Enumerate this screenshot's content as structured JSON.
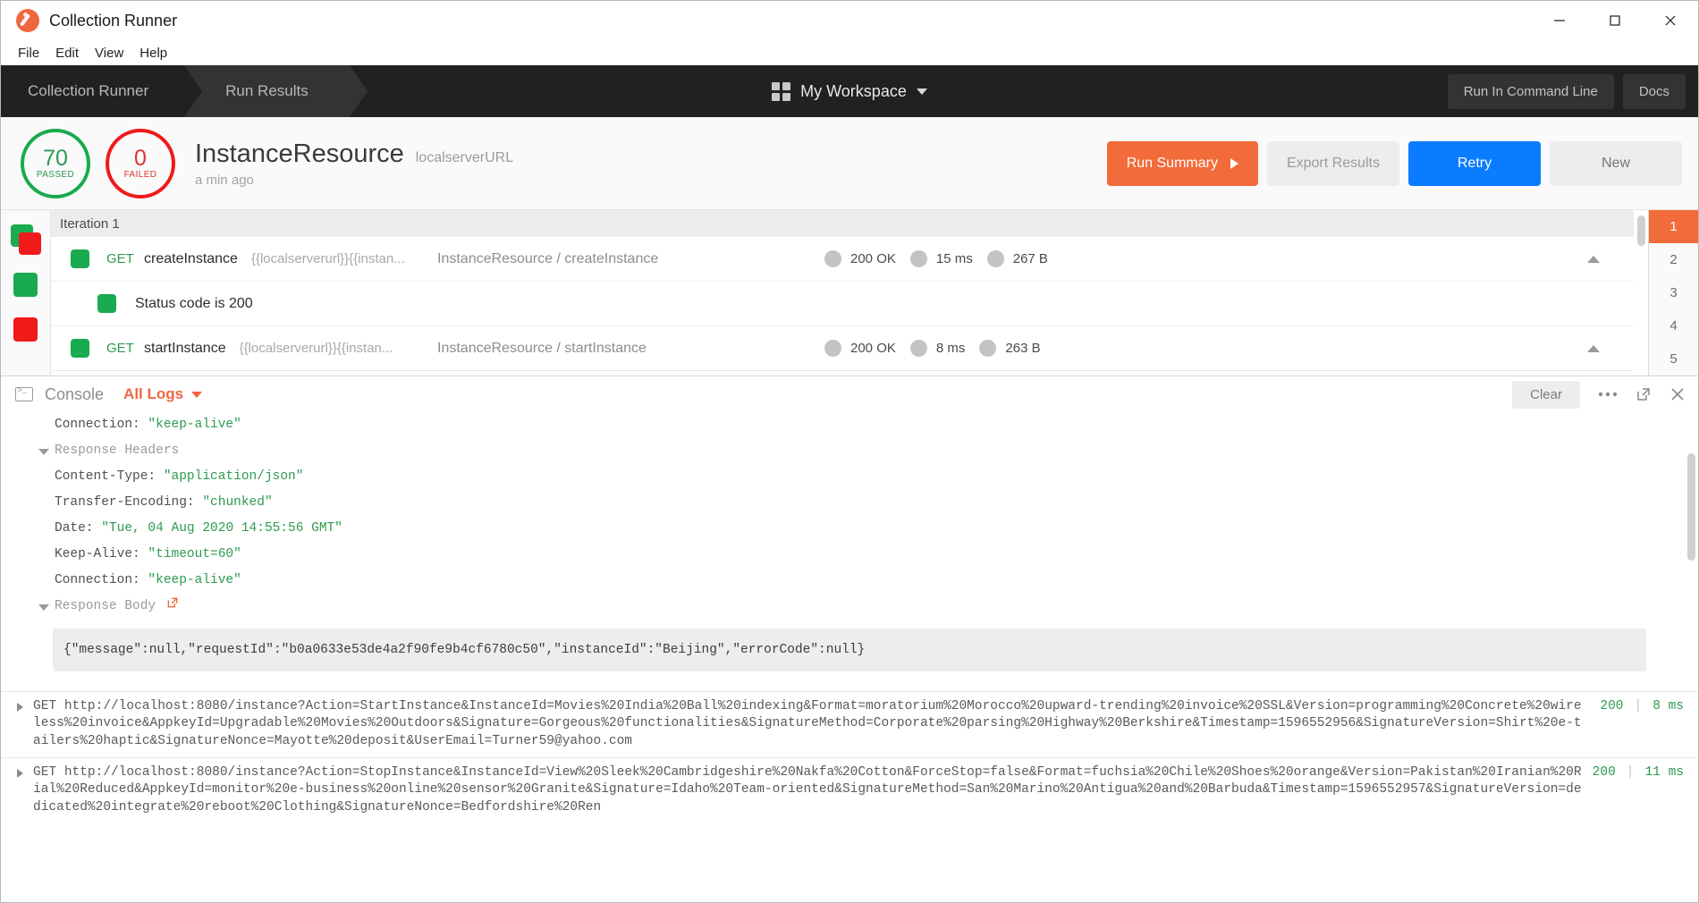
{
  "window": {
    "title": "Collection Runner",
    "minimize_label": "minimize-window",
    "maximize_label": "maximize-window",
    "close_label": "close-window"
  },
  "menubar": {
    "items": [
      "File",
      "Edit",
      "View",
      "Help"
    ]
  },
  "nav": {
    "tabs": [
      {
        "label": "Collection Runner",
        "active": false
      },
      {
        "label": "Run Results",
        "active": true
      }
    ],
    "workspace": "My Workspace",
    "buttons": [
      "Run In Command Line",
      "Docs"
    ]
  },
  "summary": {
    "passed_count": "70",
    "passed_label": "PASSED",
    "failed_count": "0",
    "failed_label": "FAILED",
    "collection_name": "InstanceResource",
    "environment": "localserverURL",
    "timestamp": "a min ago",
    "actions": {
      "run_summary": "Run Summary",
      "export_results": "Export Results",
      "retry": "Retry",
      "new": "New"
    },
    "colors": {
      "pass": "#1aaa4f",
      "fail": "#f01a1a",
      "accent": "#f26b3a",
      "retry": "#0a7cff"
    }
  },
  "results": {
    "iteration_header": "Iteration 1",
    "rows": [
      {
        "type": "request",
        "method": "GET",
        "name": "createInstance",
        "url": "{{localserverurl}}{{instan...",
        "path": "InstanceResource / createInstance",
        "status": "200 OK",
        "time": "15 ms",
        "size": "267 B"
      },
      {
        "type": "test",
        "name": "Status code is 200"
      },
      {
        "type": "request",
        "method": "GET",
        "name": "startInstance",
        "url": "{{localserverurl}}{{instan...",
        "path": "InstanceResource / startInstance",
        "status": "200 OK",
        "time": "8 ms",
        "size": "263 B"
      }
    ],
    "iterations": [
      "1",
      "2",
      "3",
      "4",
      "5"
    ],
    "active_iteration": "1"
  },
  "console": {
    "title": "Console",
    "filter": "All Logs",
    "clear_label": "Clear",
    "lines": [
      {
        "kind": "kv",
        "key": "Connection:",
        "value": "\"keep-alive\"",
        "indent": 1
      },
      {
        "kind": "group",
        "label": "Response Headers"
      },
      {
        "kind": "kv",
        "key": "Content-Type:",
        "value": "\"application/json\"",
        "indent": 1
      },
      {
        "kind": "kv",
        "key": "Transfer-Encoding:",
        "value": "\"chunked\"",
        "indent": 1
      },
      {
        "kind": "kv",
        "key": "Date:",
        "value": "\"Tue, 04 Aug 2020 14:55:56 GMT\"",
        "indent": 1
      },
      {
        "kind": "kv",
        "key": "Keep-Alive:",
        "value": "\"timeout=60\"",
        "indent": 1
      },
      {
        "kind": "kv",
        "key": "Connection:",
        "value": "\"keep-alive\"",
        "indent": 1
      },
      {
        "kind": "group",
        "label": "Response Body",
        "external_link": true
      }
    ],
    "response_body": "{\"message\":null,\"requestId\":\"b0a0633e53de4a2f90fe9b4cf6780c50\",\"instanceId\":\"Beijing\",\"errorCode\":null}",
    "request_logs": [
      {
        "method": "GET",
        "url": "http://localhost:8080/instance?Action=StartInstance&InstanceId=Movies%20India%20Ball%20indexing&Format=moratorium%20Morocco%20upward-trending%20invoice%20SSL&Version=programming%20Concrete%20wireless%20invoice&AppkeyId=Upgradable%20Movies%20Outdoors&Signature=Gorgeous%20functionalities&SignatureMethod=Corporate%20parsing%20Highway%20Berkshire&Timestamp=1596552956&SignatureVersion=Shirt%20e-tailers%20haptic&SignatureNonce=Mayotte%20deposit&UserEmail=Turner59@yahoo.com",
        "status": "200",
        "time": "8 ms"
      },
      {
        "method": "GET",
        "url": "http://localhost:8080/instance?Action=StopInstance&InstanceId=View%20Sleek%20Cambridgeshire%20Nakfa%20Cotton&ForceStop=false&Format=fuchsia%20Chile%20Shoes%20orange&Version=Pakistan%20Iranian%20Rial%20Reduced&AppkeyId=monitor%20e-business%20online%20sensor%20Granite&Signature=Idaho%20Team-oriented&SignatureMethod=San%20Marino%20Antigua%20and%20Barbuda&Timestamp=1596552957&SignatureVersion=dedicated%20integrate%20reboot%20Clothing&SignatureNonce=Bedfordshire%20Ren",
        "status": "200",
        "time": "11 ms"
      }
    ]
  }
}
